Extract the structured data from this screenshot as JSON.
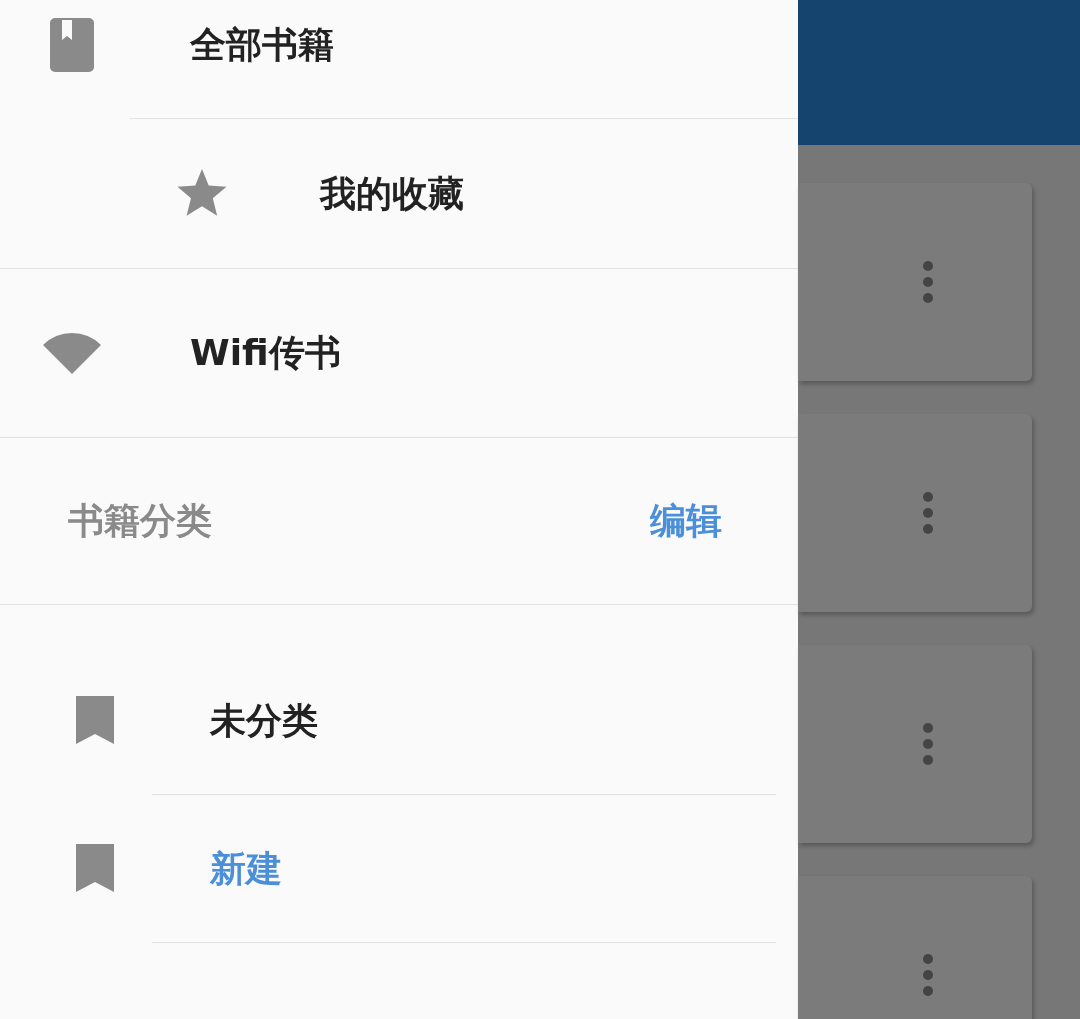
{
  "drawer": {
    "nav_items": [
      {
        "kind": "book",
        "label": "全部书籍"
      },
      {
        "kind": "star",
        "label": "我的收藏"
      },
      {
        "kind": "wifi",
        "label": "Wifi传书"
      }
    ],
    "section": {
      "title": "书籍分类",
      "action": "编辑"
    },
    "categories": [
      {
        "kind": "category",
        "label": "未分类"
      },
      {
        "kind": "action",
        "label": "新建"
      }
    ]
  },
  "background": {
    "cards": [
      {
        "kind": "card"
      },
      {
        "kind": "card"
      },
      {
        "kind": "card"
      },
      {
        "kind": "card"
      }
    ]
  }
}
